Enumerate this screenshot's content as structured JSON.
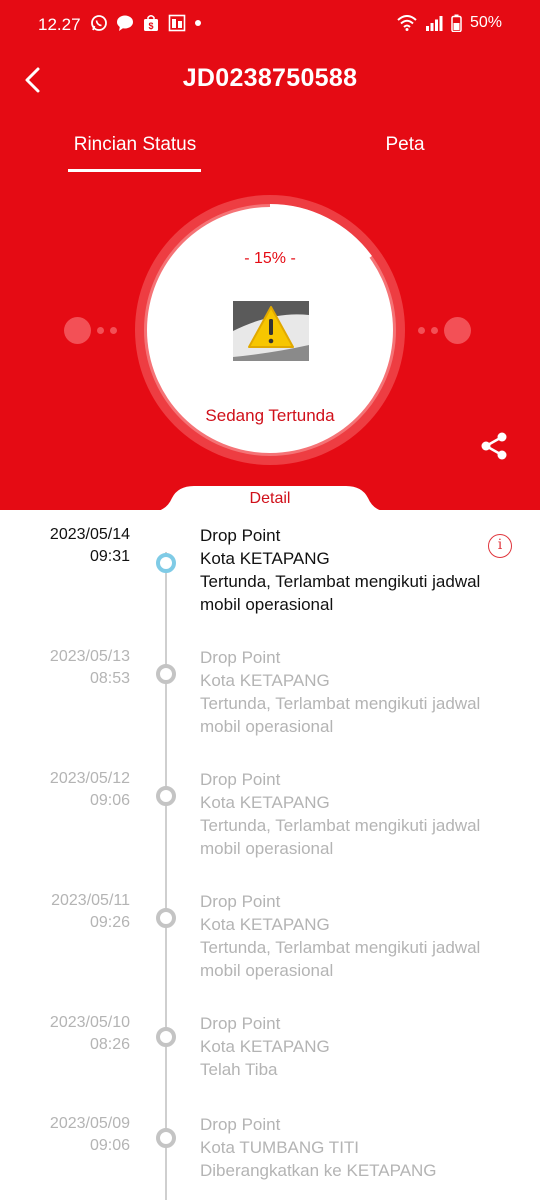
{
  "status_bar": {
    "time": "12.27",
    "battery": "50%"
  },
  "header": {
    "title": "JD0238750588",
    "back_icon": "back-arrow-icon"
  },
  "tabs": [
    {
      "label": "Rincian Status",
      "active": true
    },
    {
      "label": "Peta",
      "active": false
    }
  ],
  "progress": {
    "percent_text": "- 15% -",
    "value": 0.15,
    "status": "Sedang Tertunda",
    "image_icon": "warning-icon"
  },
  "detail_label": "Detail",
  "colors": {
    "brand_red": "#e50b14",
    "active_node": "#7fcbe6",
    "inactive_text": "#b4b4b4"
  },
  "timeline": [
    {
      "date": "2023/05/14",
      "time": "09:31",
      "line1": "Drop Point",
      "line2": "Kota KETAPANG",
      "line3": "Tertunda, Terlambat mengikuti jadwal mobil operasional",
      "active": true
    },
    {
      "date": "2023/05/13",
      "time": "08:53",
      "line1": "Drop Point",
      "line2": "Kota KETAPANG",
      "line3": "Tertunda, Terlambat mengikuti jadwal mobil operasional",
      "active": false
    },
    {
      "date": "2023/05/12",
      "time": "09:06",
      "line1": "Drop Point",
      "line2": "Kota KETAPANG",
      "line3": "Tertunda, Terlambat mengikuti jadwal mobil operasional",
      "active": false
    },
    {
      "date": "2023/05/11",
      "time": "09:26",
      "line1": "Drop Point",
      "line2": "Kota KETAPANG",
      "line3": "Tertunda, Terlambat mengikuti jadwal mobil operasional",
      "active": false
    },
    {
      "date": "2023/05/10",
      "time": "08:26",
      "line1": "Drop Point",
      "line2": "Kota KETAPANG",
      "line3": "Telah Tiba",
      "active": false
    },
    {
      "date": "2023/05/09",
      "time": "09:06",
      "line1": "Drop Point",
      "line2": "Kota TUMBANG TITI",
      "line3": "Diberangkatkan ke KETAPANG",
      "active": false
    }
  ]
}
